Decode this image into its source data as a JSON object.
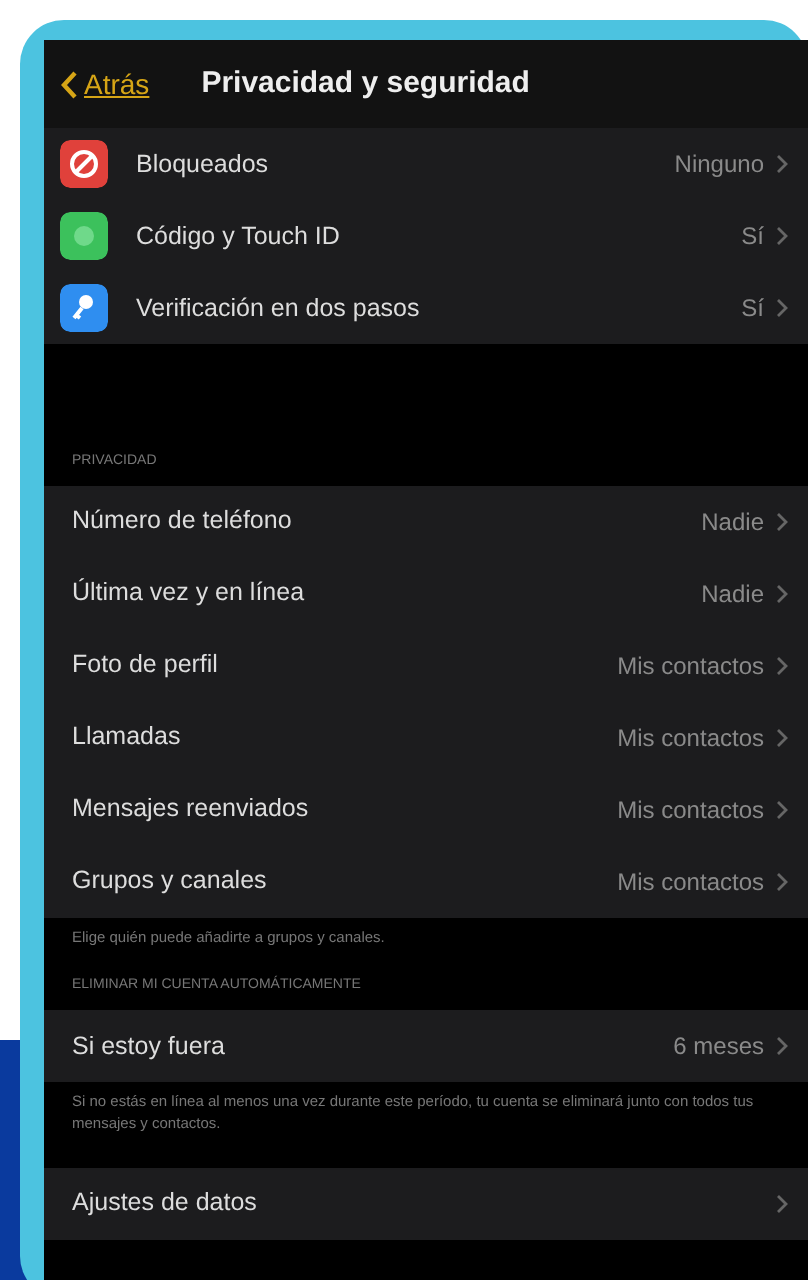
{
  "nav": {
    "back": "Atrás",
    "title": "Privacidad y seguridad"
  },
  "sections": [
    {
      "rows": [
        {
          "label": "Bloqueados",
          "value": "Ninguno"
        },
        {
          "label": "Código y Touch ID",
          "value": "Sí"
        },
        {
          "label": "Verificación en dos pasos",
          "value": "Sí"
        }
      ]
    },
    {
      "header": "PRIVACIDAD",
      "rows": [
        {
          "label": "Número de teléfono",
          "value": "Nadie"
        },
        {
          "label": "Última vez y en línea",
          "value": "Nadie"
        },
        {
          "label": "Foto de perfil",
          "value": "Mis contactos"
        },
        {
          "label": "Llamadas",
          "value": "Mis contactos"
        },
        {
          "label": "Mensajes reenviados",
          "value": "Mis contactos"
        },
        {
          "label": "Grupos y canales",
          "value": "Mis contactos"
        }
      ],
      "footer": "Elige quién puede añadirte a grupos y canales."
    },
    {
      "header": "ELIMINAR MI CUENTA AUTOMÁTICAMENTE",
      "rows": [
        {
          "label": "Si estoy fuera",
          "value": "6 meses"
        }
      ],
      "footer": "Si no estás en línea al menos una vez durante este período, tu cuenta se eliminará junto con todos tus mensajes y contactos."
    },
    {
      "rows": [
        {
          "label": "Ajustes de datos"
        }
      ]
    }
  ]
}
